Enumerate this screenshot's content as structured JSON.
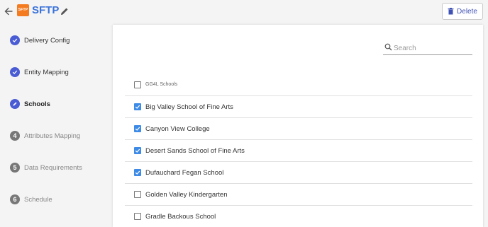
{
  "header": {
    "logo_text": "SFTP",
    "title": "SFTP",
    "delete_label": "Delete",
    "accent_color": "#3b73d9"
  },
  "steps": [
    {
      "number": "",
      "label": "Delivery Config",
      "state": "done"
    },
    {
      "number": "",
      "label": "Entity Mapping",
      "state": "done"
    },
    {
      "number": "",
      "label": "Schools",
      "state": "active"
    },
    {
      "number": "4",
      "label": "Attributes Mapping",
      "state": "todo"
    },
    {
      "number": "5",
      "label": "Data Requirements",
      "state": "todo"
    },
    {
      "number": "6",
      "label": "Schedule",
      "state": "todo"
    }
  ],
  "search": {
    "placeholder": "Search",
    "value": ""
  },
  "list": {
    "header_label": "GG4L Schools",
    "header_checked": false,
    "items": [
      {
        "name": "Big Valley School of Fine Arts",
        "checked": true
      },
      {
        "name": "Canyon View College",
        "checked": true
      },
      {
        "name": "Desert Sands School of Fine Arts",
        "checked": true
      },
      {
        "name": "Dufauchard Fegan School",
        "checked": true
      },
      {
        "name": "Golden Valley Kindergarten",
        "checked": false
      },
      {
        "name": "Gradle Backous School",
        "checked": false
      }
    ]
  }
}
